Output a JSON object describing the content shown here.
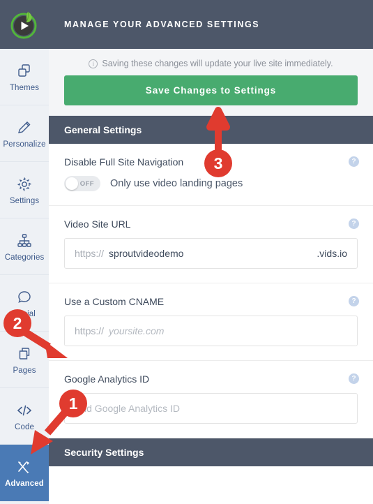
{
  "brand": {
    "logo_name": "sproutvideo-logo",
    "accent_green": "#61b33b",
    "dark": "#4d5769"
  },
  "sidebar": {
    "items": [
      {
        "label": "Themes",
        "icon": "themes-icon",
        "active": false
      },
      {
        "label": "Personalize",
        "icon": "pencil-icon",
        "active": false
      },
      {
        "label": "Settings",
        "icon": "gear-icon",
        "active": false
      },
      {
        "label": "Categories",
        "icon": "sitemap-icon",
        "active": false
      },
      {
        "label": "Social",
        "icon": "chat-bubble-icon",
        "active": false
      },
      {
        "label": "Pages",
        "icon": "pages-icon",
        "active": false
      },
      {
        "label": "Code",
        "icon": "code-icon",
        "active": false
      },
      {
        "label": "Advanced",
        "icon": "tools-icon",
        "active": true
      }
    ]
  },
  "header": {
    "title": "Manage Your Advanced Settings"
  },
  "savebar": {
    "notice": "Saving these changes will update your live site immediately.",
    "info_icon": "info-circle-icon",
    "save_label": "Save Changes to Settings",
    "save_color": "#48ab6f"
  },
  "sections": [
    {
      "title": "General Settings"
    },
    {
      "title": "Security Settings"
    }
  ],
  "fields": {
    "disable_nav": {
      "label": "Disable Full Site Navigation",
      "toggle_state": "OFF",
      "toggle_text": "Only use video landing pages",
      "help_icon": "question-help-icon"
    },
    "video_site_url": {
      "label": "Video Site URL",
      "prefix": "https://",
      "value": "sproutvideodemo",
      "suffix": ".vids.io",
      "help_icon": "question-help-icon"
    },
    "custom_cname": {
      "label": "Use a Custom CNAME",
      "prefix": "https://",
      "placeholder": "yoursite.com",
      "help_icon": "question-help-icon"
    },
    "google_analytics": {
      "label": "Google Analytics ID",
      "placeholder": "Add Google Analytics ID",
      "help_icon": "question-help-icon"
    }
  },
  "annotations": {
    "color": "#e03b2f",
    "markers": [
      {
        "number": "1",
        "target": "sidebar-item-advanced"
      },
      {
        "number": "2",
        "target": "custom-cname-input"
      },
      {
        "number": "3",
        "target": "save-changes-button"
      }
    ]
  }
}
